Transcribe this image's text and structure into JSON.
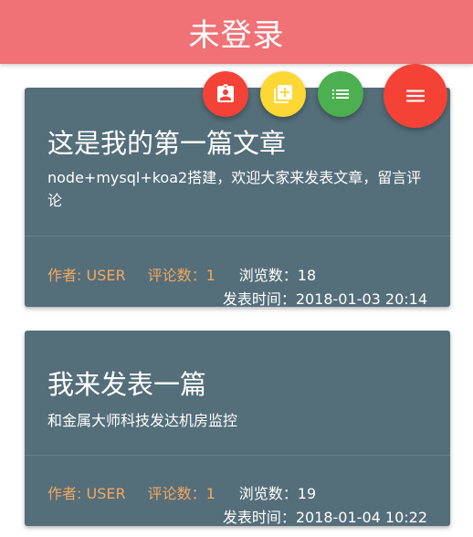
{
  "header": {
    "title": "未登录",
    "color": "#f07276"
  },
  "fabs": [
    {
      "name": "profile-icon",
      "color": "#f44336"
    },
    {
      "name": "add-to-queue-icon",
      "color": "#fdd835"
    },
    {
      "name": "list-icon",
      "color": "#4caf50"
    },
    {
      "name": "menu-icon",
      "color": "#f44336"
    }
  ],
  "articles": [
    {
      "title": "这是我的第一篇文章",
      "summary": "node+mysql+koa2搭建，欢迎大家来发表文章，留言评论",
      "author": "作者: USER",
      "comments": "评论数：1",
      "views": "浏览数：18",
      "time": "发表时间：2018-01-03 20:14"
    },
    {
      "title": "我来发表一篇",
      "summary": "和金属大师科技发达机房监控",
      "author": "作者: USER",
      "comments": "评论数：1",
      "views": "浏览数：19",
      "time": "发表时间：2018-01-04 10:22"
    }
  ],
  "colors": {
    "card": "#546e7a",
    "meta_accent": "#f5a75e"
  }
}
